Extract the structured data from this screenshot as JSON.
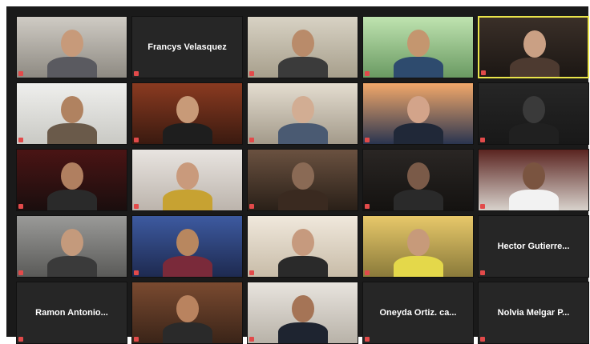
{
  "meeting": {
    "participants": [
      {
        "name": "",
        "video": true,
        "theme": "office-gray"
      },
      {
        "name": "Francys Velasquez",
        "video": false
      },
      {
        "name": "",
        "video": true,
        "theme": "room-beige"
      },
      {
        "name": "",
        "video": true,
        "theme": "window-green"
      },
      {
        "name": "",
        "video": true,
        "theme": "mask-dark",
        "active": true
      },
      {
        "name": "",
        "video": true,
        "theme": "paper-light"
      },
      {
        "name": "",
        "video": true,
        "theme": "library-red"
      },
      {
        "name": "",
        "video": true,
        "theme": "room-light"
      },
      {
        "name": "",
        "video": true,
        "theme": "sunset-blue"
      },
      {
        "name": "",
        "video": true,
        "theme": "dark-silhouette"
      },
      {
        "name": "",
        "video": true,
        "theme": "dark-red"
      },
      {
        "name": "",
        "video": true,
        "theme": "selfie"
      },
      {
        "name": "",
        "video": true,
        "theme": "ceiling-brown"
      },
      {
        "name": "",
        "video": true,
        "theme": "dim-room"
      },
      {
        "name": "",
        "video": true,
        "theme": "maroon-wall"
      },
      {
        "name": "",
        "video": true,
        "theme": "shelf-gray"
      },
      {
        "name": "",
        "video": true,
        "theme": "poster-blue"
      },
      {
        "name": "",
        "video": true,
        "theme": "cream-room"
      },
      {
        "name": "",
        "video": true,
        "theme": "yellow-office"
      },
      {
        "name": "Hector Gutierre...",
        "video": false
      },
      {
        "name": "Ramon Antonio...",
        "video": false
      },
      {
        "name": "",
        "video": true,
        "theme": "door-brown"
      },
      {
        "name": "",
        "video": true,
        "theme": "suit-light"
      },
      {
        "name": "Oneyda Ortiz. ca...",
        "video": false
      },
      {
        "name": "Nolvia Melgar P...",
        "video": false
      }
    ]
  },
  "colors": {
    "background": "#1a1a1a",
    "tile": "#262626",
    "active_speaker_border": "#e9e44a",
    "name_text": "#ffffff",
    "muted_icon": "#e24a4a"
  }
}
